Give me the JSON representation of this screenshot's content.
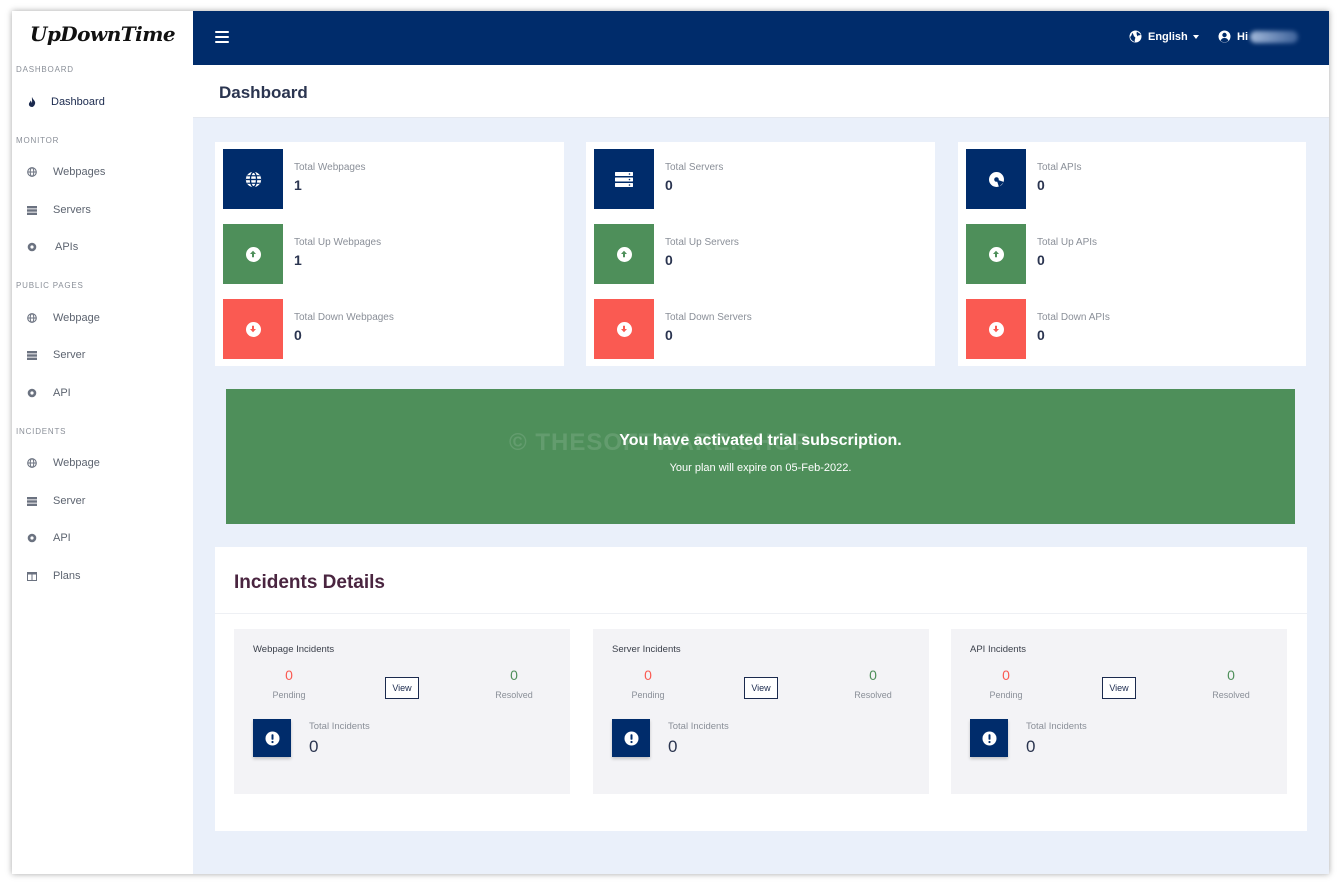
{
  "app": {
    "logo": "UpDownTime"
  },
  "sidebar": {
    "sections": {
      "dashboard": "DASHBOARD",
      "monitor": "MONITOR",
      "public_pages": "PUBLIC PAGES",
      "incidents": "INCIDENTS"
    },
    "items": {
      "dashboard": "Dashboard",
      "webpages": "Webpages",
      "servers": "Servers",
      "apis": "APIs",
      "public_webpage": "Webpage",
      "public_server": "Server",
      "public_api": "API",
      "incident_webpage": "Webpage",
      "incident_server": "Server",
      "incident_api": "API",
      "plans": "Plans"
    }
  },
  "topbar": {
    "language": "English",
    "greeting": "Hi"
  },
  "page": {
    "title": "Dashboard"
  },
  "stats": {
    "webpages": {
      "total_label": "Total Webpages",
      "total": "1",
      "up_label": "Total Up Webpages",
      "up": "1",
      "down_label": "Total Down Webpages",
      "down": "0"
    },
    "servers": {
      "total_label": "Total Servers",
      "total": "0",
      "up_label": "Total Up Servers",
      "up": "0",
      "down_label": "Total Down Servers",
      "down": "0"
    },
    "apis": {
      "total_label": "Total APIs",
      "total": "0",
      "up_label": "Total Up APIs",
      "up": "0",
      "down_label": "Total Down APIs",
      "down": "0"
    }
  },
  "banner": {
    "title": "You have activated trial subscription.",
    "subtitle": "Your plan will expire on 05-Feb-2022.",
    "watermark": "© THESOFTWARE.SHOP"
  },
  "incidents": {
    "heading": "Incidents Details",
    "cards": [
      {
        "title": "Webpage Incidents",
        "pending": "0",
        "pending_label": "Pending",
        "resolved": "0",
        "resolved_label": "Resolved",
        "view": "View",
        "total_label": "Total Incidents",
        "total": "0"
      },
      {
        "title": "Server Incidents",
        "pending": "0",
        "pending_label": "Pending",
        "resolved": "0",
        "resolved_label": "Resolved",
        "view": "View",
        "total_label": "Total Incidents",
        "total": "0"
      },
      {
        "title": "API Incidents",
        "pending": "0",
        "pending_label": "Pending",
        "resolved": "0",
        "resolved_label": "Resolved",
        "view": "View",
        "total_label": "Total Incidents",
        "total": "0"
      }
    ]
  },
  "colors": {
    "navy": "#002c6b",
    "green": "#4e8f5a",
    "red": "#fa5a52",
    "background": "#eaf0fa"
  }
}
